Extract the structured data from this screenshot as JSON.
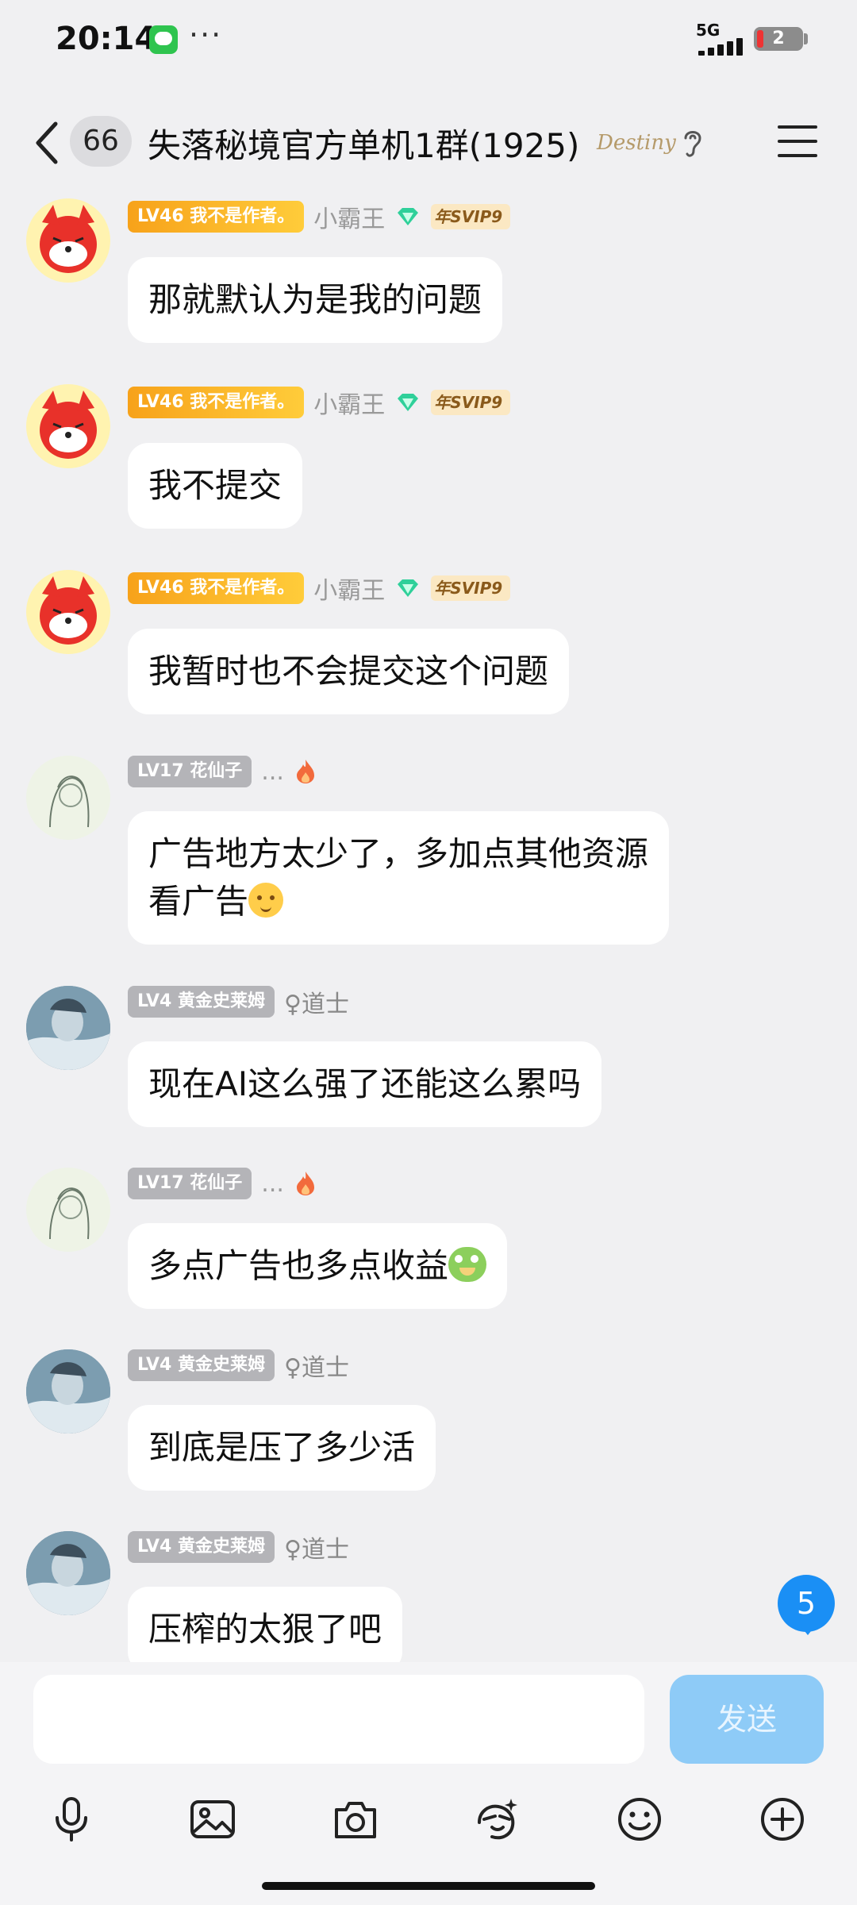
{
  "status_bar": {
    "time": "20:14",
    "more": "···",
    "network": "5G",
    "battery_level": "2"
  },
  "header": {
    "unread_count": "66",
    "title": "失落秘境官方单机1群(1925)",
    "group_badge": "Destiny"
  },
  "messages": [
    {
      "level": "LV46 我不是作者。",
      "name": "小霸王",
      "vip": "年SVIP9",
      "text": "那就默认为是我的问题"
    },
    {
      "level": "LV46 我不是作者。",
      "name": "小霸王",
      "vip": "年SVIP9",
      "text": "我不提交"
    },
    {
      "level": "LV46 我不是作者。",
      "name": "小霸王",
      "vip": "年SVIP9",
      "text": "我暂时也不会提交这个问题"
    },
    {
      "level": "LV17 花仙子",
      "name": "...",
      "text_line1": "广告地方太少了，多加点其他资源",
      "text_line2": "看广告"
    },
    {
      "level": "LV4 黄金史莱姆",
      "title_tag": "♀道士",
      "text": "现在AI这么强了还能这么累吗"
    },
    {
      "level": "LV17 花仙子",
      "name": "...",
      "text": "多点广告也多点收益"
    },
    {
      "level": "LV4 黄金史莱姆",
      "title_tag": "♀道士",
      "text": "到底是压了多少活"
    },
    {
      "level": "LV4 黄金史莱姆",
      "title_tag": "♀道士",
      "text": "压榨的太狠了吧"
    }
  ],
  "new_messages_count": "5",
  "input": {
    "placeholder": "",
    "send_label": "发送"
  },
  "toolbar": [
    "mic-icon",
    "image-icon",
    "camera-icon",
    "sticker-icon",
    "emoji-icon",
    "plus-icon"
  ],
  "colors": {
    "background": "#f0f0f2",
    "send_button": "#8ecbf7",
    "new_badge": "#1a8ff5",
    "level_gold": "#f7a21a",
    "level_gray": "#b4b4b8"
  }
}
